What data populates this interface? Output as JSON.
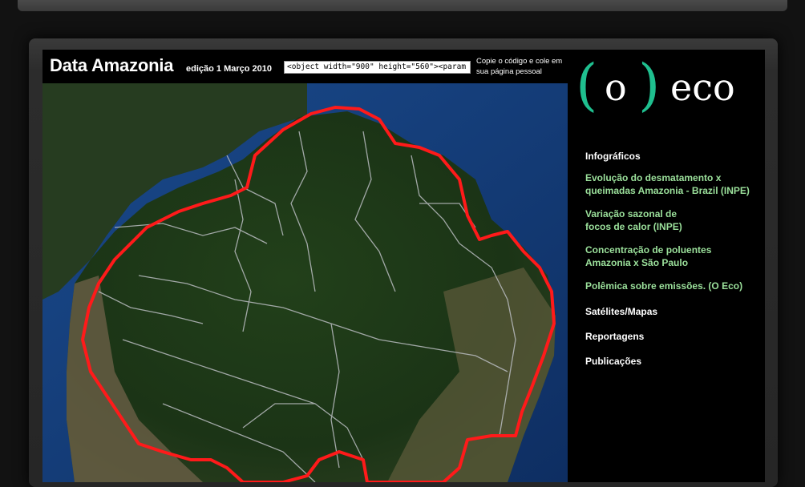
{
  "header": {
    "title": "Data Amazonia",
    "edition": "edição 1 Março 2010",
    "embed_code": "<object width=\"900\" height=\"560\"><param na",
    "embed_hint": "Copie o código e cole em sua página pessoal"
  },
  "logo": {
    "open": "(",
    "letter": "o",
    "close": ")",
    "word": "eco"
  },
  "nav": {
    "infographics": "Infográficos",
    "links": [
      "Evolução do desmatamento x\nqueimadas Amazonia - Brazil (INPE)",
      "Variação sazonal de\nfocos de calor (INPE)",
      "Concentração de poluentes\nAmazonia x São Paulo",
      "Polêmica sobre emissões. (O Eco)"
    ],
    "sections": [
      "Satélites/Mapas",
      "Reportagens",
      "Publicações"
    ]
  },
  "colors": {
    "link": "#9be09b",
    "boundary": "#ff1a1a",
    "logo_green": "#1fbf8f",
    "ocean": "#123a78",
    "forest": "#1f3a18"
  },
  "map": {
    "description_icon": "satellite-map"
  }
}
